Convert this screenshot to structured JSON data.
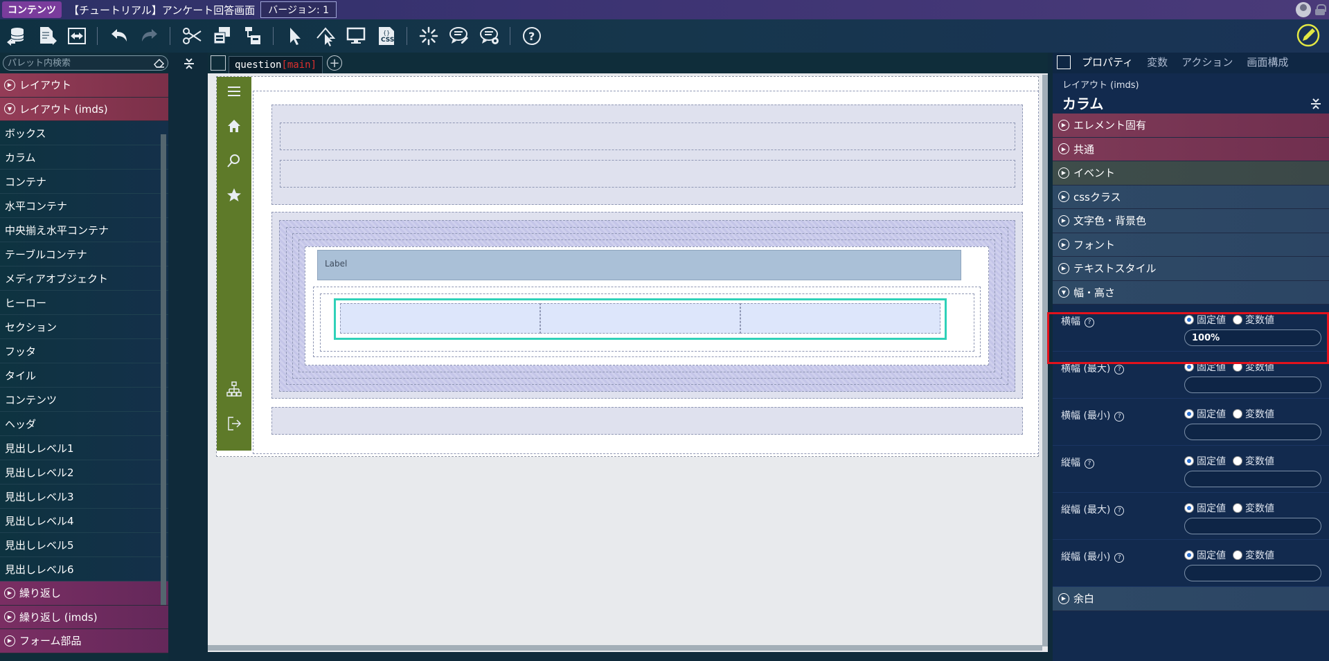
{
  "titlebar": {
    "badge": "コンテンツ",
    "title": "【チュートリアル】アンケート回答画面",
    "version": "バージョン: 1"
  },
  "palette": {
    "search_placeholder": "パレット内検索",
    "groups": [
      {
        "label": "レイアウト",
        "expanded": false
      },
      {
        "label": "レイアウト (imds)",
        "expanded": true
      }
    ],
    "items": [
      "ボックス",
      "カラム",
      "コンテナ",
      "水平コンテナ",
      "中央揃え水平コンテナ",
      "テーブルコンテナ",
      "メディアオブジェクト",
      "ヒーロー",
      "セクション",
      "フッタ",
      "タイル",
      "コンテンツ",
      "ヘッダ",
      "見出しレベル1",
      "見出しレベル2",
      "見出しレベル3",
      "見出しレベル4",
      "見出しレベル5",
      "見出しレベル6"
    ],
    "bottom_groups": [
      "繰り返し",
      "繰り返し (imds)",
      "フォーム部品"
    ]
  },
  "editor": {
    "tab_name": "question",
    "tab_suffix": "[main]",
    "label_text": "Label"
  },
  "right_panel": {
    "tabs": [
      "プロパティ",
      "変数",
      "アクション",
      "画面構成"
    ],
    "subtitle": "レイアウト (imds)",
    "title": "カラム",
    "sections": [
      {
        "label": "エレメント固有",
        "color": "red"
      },
      {
        "label": "共通",
        "color": "red"
      },
      {
        "label": "イベント",
        "color": "green"
      },
      {
        "label": "cssクラス",
        "color": "blue"
      },
      {
        "label": "文字色・背景色",
        "color": "blue"
      },
      {
        "label": "フォント",
        "color": "blue"
      },
      {
        "label": "テキストスタイル",
        "color": "blue"
      }
    ],
    "size_section": "幅・高さ",
    "fixed_label": "固定値",
    "variable_label": "変数値",
    "size_fields": [
      {
        "label": "横幅",
        "value": "100%"
      },
      {
        "label": "横幅 (最大)",
        "value": ""
      },
      {
        "label": "横幅 (最小)",
        "value": ""
      },
      {
        "label": "縦幅",
        "value": ""
      },
      {
        "label": "縦幅 (最大)",
        "value": ""
      },
      {
        "label": "縦幅 (最小)",
        "value": ""
      }
    ],
    "margin_section": "余白"
  }
}
